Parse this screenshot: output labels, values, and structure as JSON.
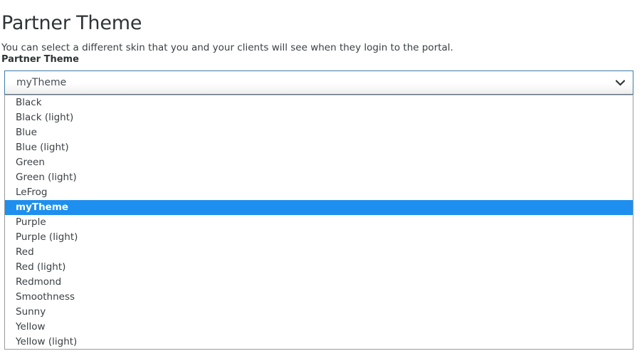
{
  "page": {
    "title": "Partner Theme",
    "description": "You can select a different skin that you and your clients will see when they login to the portal."
  },
  "field": {
    "label": "Partner Theme",
    "name": "partner-theme",
    "selected_value": "myTheme",
    "expanded": true,
    "arrow_icon": "chevron-down-icon"
  },
  "colors": {
    "highlight": "#1e8fef",
    "highlight_text": "#ffffff",
    "select_border": "#3d7da8",
    "panel_border": "#9a9a9a",
    "text": "#3b4044",
    "title_text": "#2e3436"
  },
  "dropdown": {
    "options": [
      {
        "label": "Black",
        "selected": false
      },
      {
        "label": "Black (light)",
        "selected": false
      },
      {
        "label": "Blue",
        "selected": false
      },
      {
        "label": "Blue (light)",
        "selected": false
      },
      {
        "label": "Green",
        "selected": false
      },
      {
        "label": "Green (light)",
        "selected": false
      },
      {
        "label": "LeFrog",
        "selected": false
      },
      {
        "label": "myTheme",
        "selected": true
      },
      {
        "label": "Purple",
        "selected": false
      },
      {
        "label": "Purple (light)",
        "selected": false
      },
      {
        "label": "Red",
        "selected": false
      },
      {
        "label": "Red (light)",
        "selected": false
      },
      {
        "label": "Redmond",
        "selected": false
      },
      {
        "label": "Smoothness",
        "selected": false
      },
      {
        "label": "Sunny",
        "selected": false
      },
      {
        "label": "Yellow",
        "selected": false
      },
      {
        "label": "Yellow (light)",
        "selected": false
      }
    ]
  }
}
